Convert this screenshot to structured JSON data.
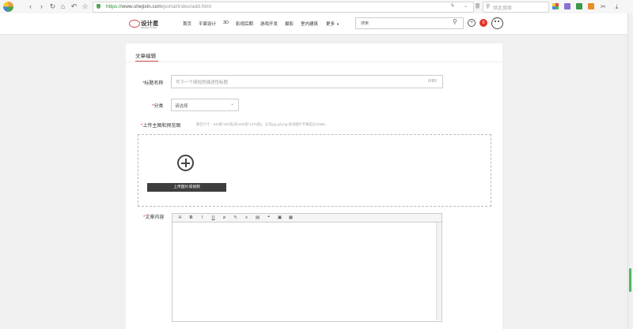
{
  "browser": {
    "url_protocol": "https://",
    "url_host": "www.shejixin.com",
    "url_path": "/portal/index/add.html",
    "search_placeholder": "供此搜索"
  },
  "site": {
    "logo_text": "设计星",
    "logo_sub": "DESIGN STAR",
    "nav": [
      "首页",
      "平面设计",
      "3D",
      "影视后期",
      "游戏开发",
      "摄影",
      "室内建筑",
      "更多"
    ],
    "search_value": "搜索",
    "notification_count": "0"
  },
  "form": {
    "tab_label": "文章编辑",
    "title_label": "标题名称",
    "title_placeholder": "写下一个简短的描述性标题",
    "title_counter": "0/80",
    "category_label": "分类",
    "category_value": "请选择",
    "upload_label": "上传主图和预览图",
    "upload_hint": "最佳尺寸：640宽*430高(或1600宽*1075高)，支持jpg,gif,png,每张图片不要超过10MB。",
    "upload_button": "上传图片或视频",
    "content_label": "文章内容",
    "required_mark": "*",
    "toolbar": [
      "H",
      "B",
      "I",
      "U",
      "⌀",
      "✎",
      "≡",
      "▤",
      "❝",
      "▣",
      "▦"
    ]
  },
  "colors": {
    "accent_red": "#d24a4a",
    "scroll_green": "#4cb860"
  }
}
